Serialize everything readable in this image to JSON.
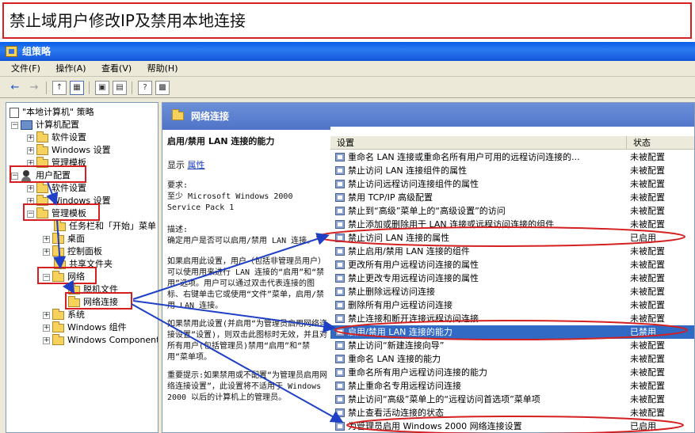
{
  "caption": "禁止域用户修改IP及禁用本地连接",
  "window": {
    "title": "组策略"
  },
  "menu": [
    "文件(F)",
    "操作(A)",
    "查看(V)",
    "帮助(H)"
  ],
  "toolbar": {
    "back_icon": "back-arrow-icon",
    "forward_icon": "forward-arrow-icon"
  },
  "tree": {
    "root": "\"本地计算机\" 策略",
    "computer_config": "计算机配置",
    "software_settings": "软件设置",
    "windows_settings": "Windows 设置",
    "admin_templates": "管理模板",
    "user_config": "用户配置",
    "user_software_settings": "软件设置",
    "user_windows_settings": "Windows 设置",
    "user_admin_templates": "管理模板",
    "taskbar_start": "任务栏和「开始」菜单",
    "desktop": "桌面",
    "control_panel": "控制面板",
    "shared_folders": "共享文件夹",
    "network": "网络",
    "offline_files": "脱机文件",
    "network_connections": "网络连接",
    "system": "系统",
    "windows_components": "Windows 组件",
    "windows_components_en": "Windows Components"
  },
  "panel": {
    "title": "网络连接",
    "policy_title": "启用/禁用 LAN 连接的能力",
    "show_label": "显示",
    "properties_link": "属性",
    "requirements_label": "要求:",
    "requirements_text": "至少 Microsoft Windows 2000 Service Pack 1",
    "description_label": "描述:",
    "description_text": "确定用户是否可以启用/禁用 LAN 连接。",
    "para1": "如果启用此设置，用户（包括非管理员用户）可以使用用来进行 LAN 连接的“启用”和“禁用”选项。用户可以通过双击代表连接的图标、右键单击它或使用“文件”菜单，启用/禁用 LAN 连接。",
    "para2": "如果禁用此设置(并启用“为管理员启用网络连接设置”设置)，则双击此图标时无效，并且对所有用户(包括管理员)禁用“启用”和“禁用”菜单项。",
    "para3": "重要提示:如果禁用或不配置“为管理员启用网络连接设置”，此设置将不适用于 Windows 2000 以后的计算机上的管理员。"
  },
  "list": {
    "col_setting": "设置",
    "col_state": "状态",
    "rows": [
      {
        "name": "重命名 LAN 连接或重命名所有用户可用的远程访问连接的...",
        "state": "未被配置"
      },
      {
        "name": "禁止访问 LAN 连接组件的属性",
        "state": "未被配置"
      },
      {
        "name": "禁止访问远程访问连接组件的属性",
        "state": "未被配置"
      },
      {
        "name": "禁用 TCP/IP 高级配置",
        "state": "未被配置"
      },
      {
        "name": "禁止到“高级”菜单上的“高级设置”的访问",
        "state": "未被配置"
      },
      {
        "name": "禁止添加或删除用于 LAN 连接或远程访问连接的组件",
        "state": "未被配置"
      },
      {
        "name": "禁止访问 LAN 连接的属性",
        "state": "已启用"
      },
      {
        "name": "禁止启用/禁用 LAN 连接的组件",
        "state": "未被配置"
      },
      {
        "name": "更改所有用户远程访问连接的属性",
        "state": "未被配置"
      },
      {
        "name": "禁止更改专用远程访问连接的属性",
        "state": "未被配置"
      },
      {
        "name": "禁止删除远程访问连接",
        "state": "未被配置"
      },
      {
        "name": "删除所有用户远程访问连接",
        "state": "未被配置"
      },
      {
        "name": "禁止连接和断开连接远程访问连接",
        "state": "未被配置"
      },
      {
        "name": "启用/禁用 LAN 连接的能力",
        "state": "已禁用"
      },
      {
        "name": "禁止访问“新建连接向导”",
        "state": "未被配置"
      },
      {
        "name": "重命名 LAN 连接的能力",
        "state": "未被配置"
      },
      {
        "name": "重命名所有用户远程访问连接的能力",
        "state": "未被配置"
      },
      {
        "name": "禁止重命名专用远程访问连接",
        "state": "未被配置"
      },
      {
        "name": "禁止访问“高级”菜单上的“远程访问首选项”菜单项",
        "state": "未被配置"
      },
      {
        "name": "禁止查看活动连接的状态",
        "state": "未被配置"
      },
      {
        "name": "为管理员启用 Windows 2000 网络连接设置",
        "state": "已启用"
      }
    ]
  },
  "colors": {
    "annotation_red": "#d42020",
    "arrow_blue": "#1f3fc4",
    "selection_blue": "#316ac5"
  }
}
